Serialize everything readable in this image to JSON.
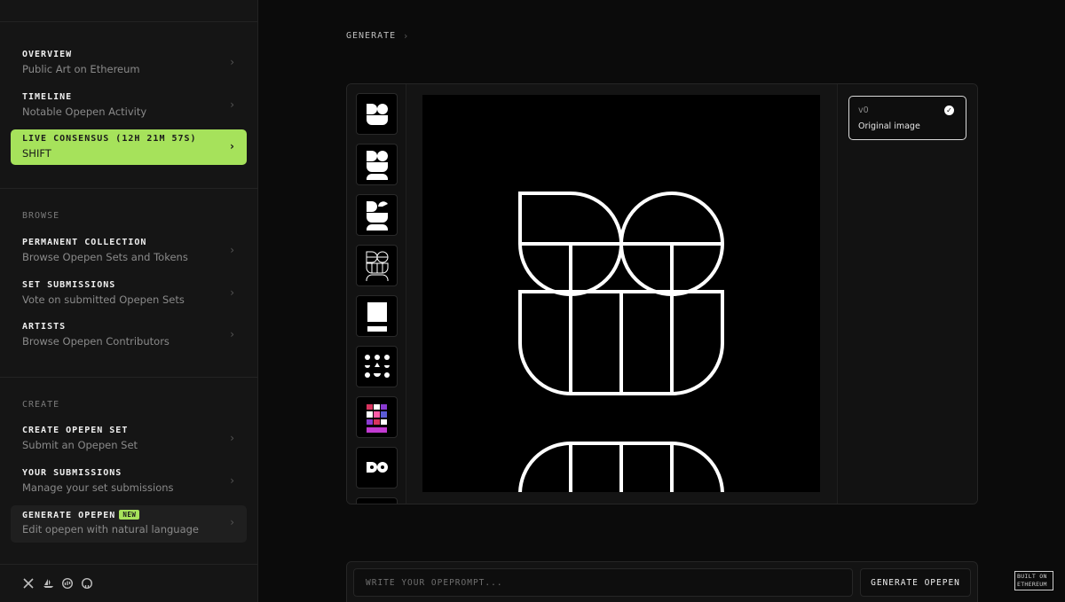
{
  "sidebar": {
    "top_items": [
      {
        "title": "OVERVIEW",
        "subtitle": "Public Art on Ethereum"
      },
      {
        "title": "TIMELINE",
        "subtitle": "Notable Opepen Activity"
      },
      {
        "title": "LIVE CONSENSUS (12H 21M 57S)",
        "subtitle": "SHIFT"
      }
    ],
    "browse_label": "BROWSE",
    "browse_items": [
      {
        "title": "PERMANENT COLLECTION",
        "subtitle": "Browse Opepen Sets and Tokens"
      },
      {
        "title": "SET SUBMISSIONS",
        "subtitle": "Vote on submitted Opepen Sets"
      },
      {
        "title": "ARTISTS",
        "subtitle": "Browse Opepen Contributors"
      }
    ],
    "create_label": "CREATE",
    "create_items": [
      {
        "title": "CREATE OPEPEN SET",
        "subtitle": "Submit an Opepen Set"
      },
      {
        "title": "YOUR SUBMISSIONS",
        "subtitle": "Manage your set submissions"
      },
      {
        "title": "GENERATE OPEPEN",
        "subtitle": "Edit opepen with natural language",
        "badge": "NEW"
      }
    ],
    "socials": [
      "x-icon",
      "opensea-icon",
      "etherscan-icon",
      "github-icon"
    ]
  },
  "breadcrumb": {
    "current": "GENERATE"
  },
  "versions": [
    {
      "id": "v0",
      "label": "Original image"
    }
  ],
  "prompt": {
    "placeholder": "WRITE YOUR OPEPROMPT...",
    "button": "GENERATE OPEPEN"
  },
  "footer_badge": {
    "line1": "BUILT ON",
    "line2": "ETHEREUM"
  },
  "colors": {
    "accent": "#a6e25b",
    "background": "#0b0b0b",
    "sidebar": "#151515"
  }
}
